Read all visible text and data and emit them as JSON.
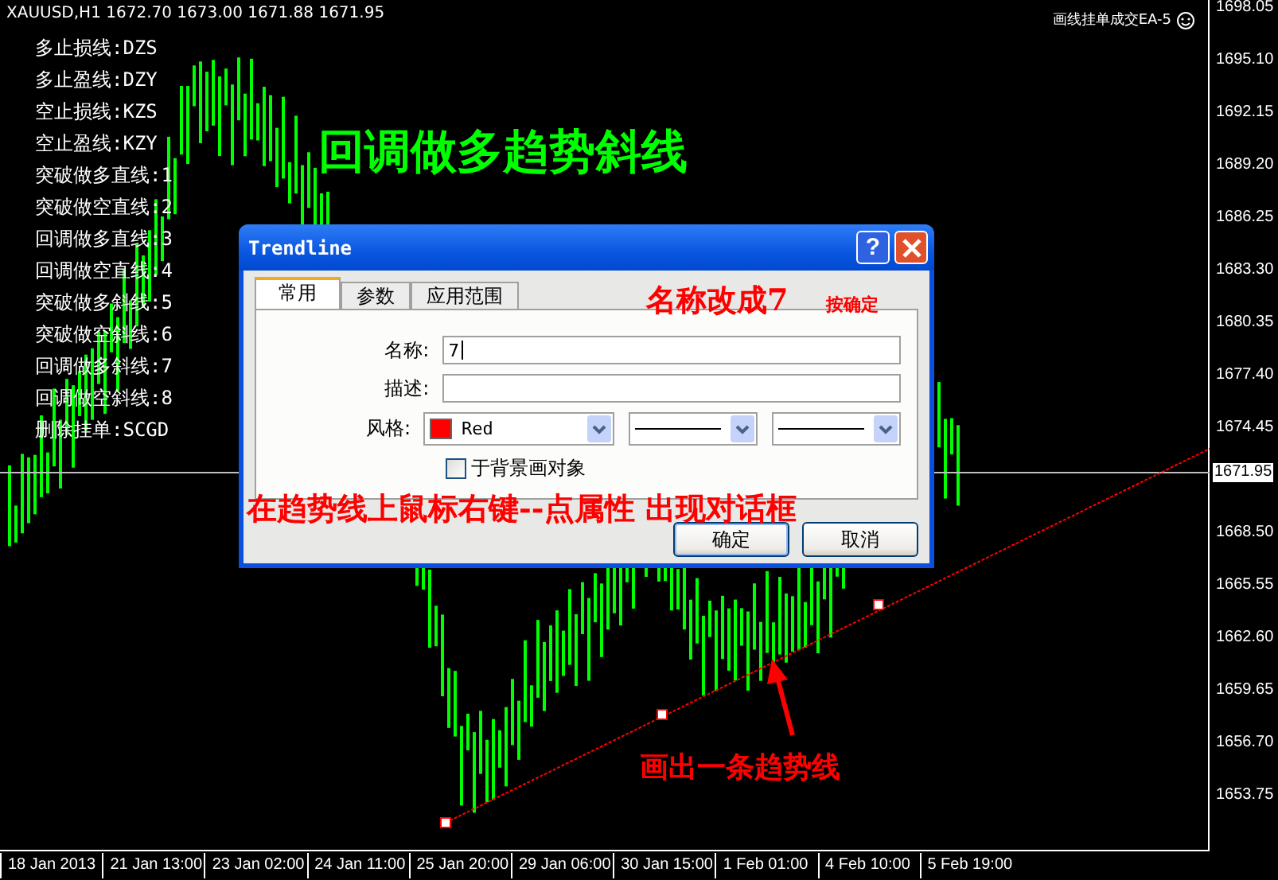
{
  "chart": {
    "symbol_info": "XAUUSD,H1  1672.70 1673.00 1671.88 1671.95",
    "ea_label": "画线挂单成交EA-5",
    "legend": [
      "多止损线:DZS",
      "多止盈线:DZY",
      "空止损线:KZS",
      "空止盈线:KZY",
      "突破做多直线:1",
      "突破做空直线:2",
      "回调做多直线:3",
      "回调做空直线:4",
      "突破做多斜线:5",
      "突破做空斜线:6",
      "回调做多斜线:7",
      "回调做空斜线:8",
      "删除挂单:SCGD"
    ],
    "heading": "回调做多趋势斜线",
    "price_axis": [
      "1698.05",
      "1695.10",
      "1692.15",
      "1689.20",
      "1686.25",
      "1683.30",
      "1680.35",
      "1677.40",
      "1674.45",
      "1668.50",
      "1665.55",
      "1662.60",
      "1659.65",
      "1656.70",
      "1653.75"
    ],
    "current_price": "1671.95",
    "time_axis": [
      "18 Jan 2013",
      "21 Jan 13:00",
      "23 Jan 02:00",
      "24 Jan 11:00",
      "25 Jan 20:00",
      "29 Jan 06:00",
      "30 Jan 15:00",
      "1 Feb 01:00",
      "4 Feb 10:00",
      "5 Feb 19:00"
    ]
  },
  "dialog": {
    "title": "Trendline",
    "help_button": "?",
    "tabs": [
      {
        "label": "常用",
        "selected": true
      },
      {
        "label": "参数",
        "selected": false
      },
      {
        "label": "应用范围",
        "selected": false
      }
    ],
    "fields": [
      {
        "kind": "text",
        "label": "名称:",
        "value": "7"
      },
      {
        "kind": "text",
        "label": "描述:"
      },
      {
        "kind": "style",
        "label": "风格:",
        "color_name": "Red"
      }
    ],
    "checkbox": {
      "label": "于背景画对象",
      "checked": false
    },
    "buttons": [
      "确定",
      "取消"
    ]
  },
  "annotations": {
    "rename": "名称改成7",
    "confirm": "按确定",
    "instruction": "在趋势线上鼠标右键--点属性 出现对话框",
    "draw": "画出一条趋势线"
  }
}
